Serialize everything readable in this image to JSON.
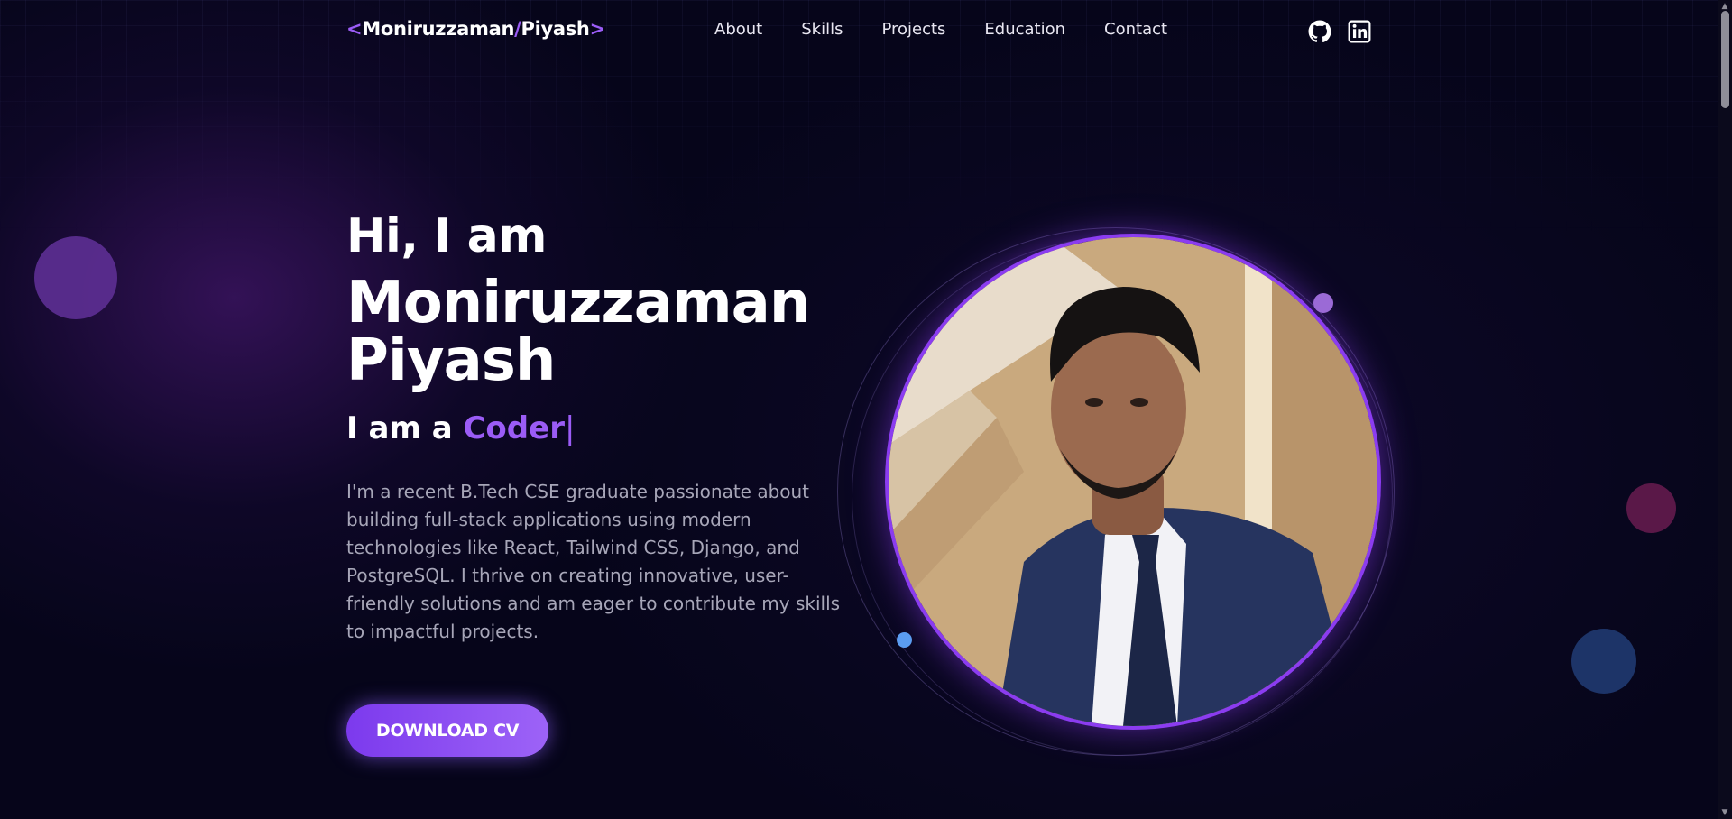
{
  "nav": {
    "logo": {
      "open": "<",
      "first": "Moniruzzaman",
      "slash": "/",
      "last": "Piyash",
      "close": ">"
    },
    "links": [
      "About",
      "Skills",
      "Projects",
      "Education",
      "Contact"
    ],
    "social": [
      "github-icon",
      "linkedin-icon"
    ]
  },
  "hero": {
    "greeting": "Hi, I am",
    "name_line1": "Moniruzzaman",
    "name_line2": "Piyash",
    "role_prefix": "I am a ",
    "role": "Coder",
    "cursor": "|",
    "description": "I'm a recent B.Tech CSE graduate passionate about building full-stack applications using modern technologies like React, Tailwind CSS, Django, and PostgreSQL. I thrive on creating innovative, user-friendly solutions and am eager to contribute my skills to impactful projects.",
    "cta": "DOWNLOAD CV"
  },
  "colors": {
    "accent": "#8b3cf0",
    "background": "#06051a",
    "text_muted": "#a7a6b8"
  }
}
